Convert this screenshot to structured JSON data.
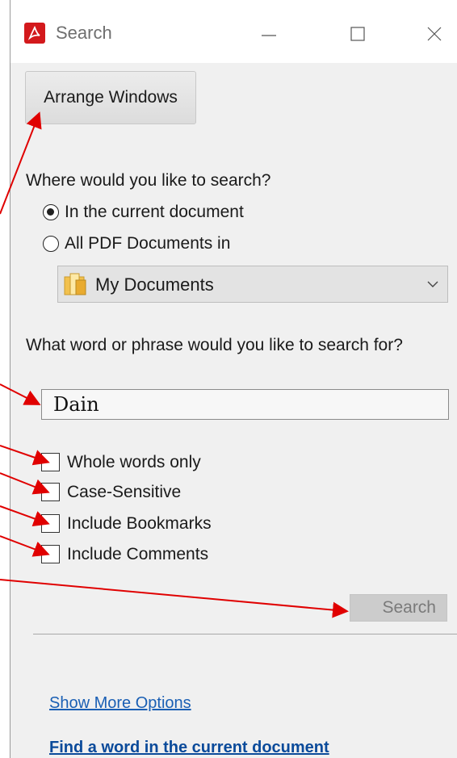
{
  "window": {
    "title": "Search",
    "app_icon": "acrobat-icon",
    "controls": [
      "minimize-icon",
      "maximize-icon",
      "close-icon"
    ]
  },
  "arrange_button": {
    "label": "Arrange Windows"
  },
  "where": {
    "question": "Where would you like to search?",
    "options": [
      {
        "label": "In the current document",
        "selected": true
      },
      {
        "label": "All PDF Documents in",
        "selected": false
      }
    ],
    "location": {
      "value": "My Documents",
      "icon": "folder-icon"
    }
  },
  "what": {
    "question": "What word or phrase would you like to search for?",
    "value": "Dain"
  },
  "options": [
    {
      "label": "Whole words only",
      "checked": false
    },
    {
      "label": "Case-Sensitive",
      "checked": false
    },
    {
      "label": "Include Bookmarks",
      "checked": false
    },
    {
      "label": "Include Comments",
      "checked": false
    }
  ],
  "search_button": {
    "label": "Search",
    "enabled": false
  },
  "links": {
    "more_options": "Show More Options",
    "find_word": "Find a word in the current document"
  },
  "annotation_color": "#e00000"
}
